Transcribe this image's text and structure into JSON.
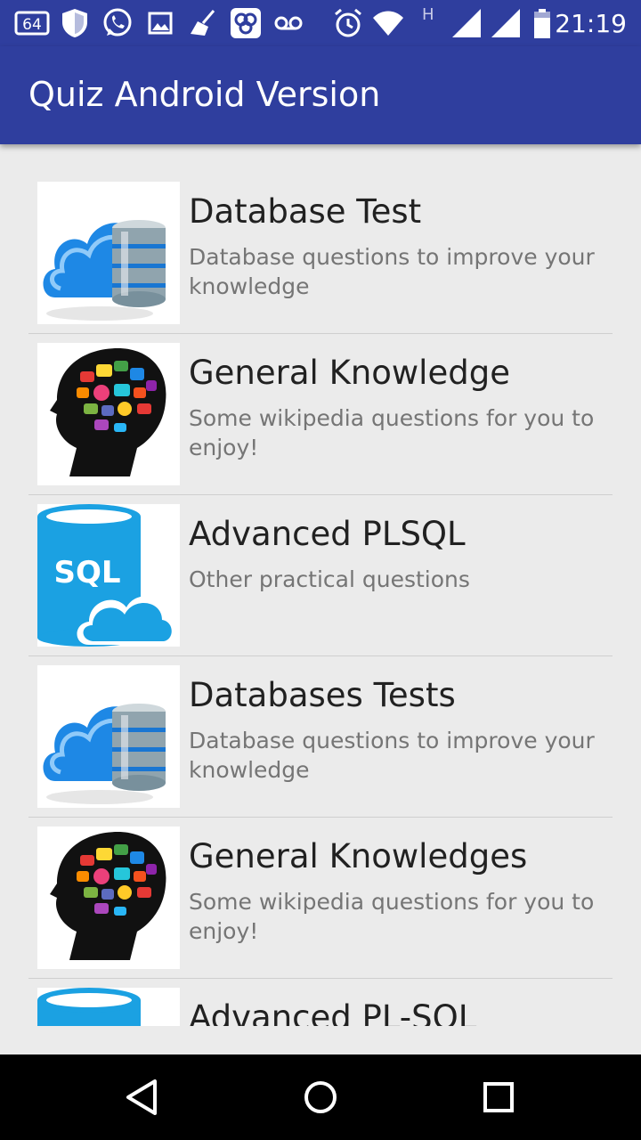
{
  "status_bar": {
    "notification_count": "64",
    "network_type": "H",
    "time": "21:19",
    "icons": [
      "notification-count-icon",
      "shield-icon",
      "whatsapp-icon",
      "image-icon",
      "cleaner-icon",
      "app-icon",
      "voicemail-icon",
      "alarm-icon",
      "wifi-icon",
      "network-h-icon",
      "signal-icon",
      "signal-icon",
      "battery-icon"
    ]
  },
  "app_bar": {
    "title": "Quiz Android Version",
    "color": "#2f3e9e"
  },
  "quizzes": [
    {
      "title": "Database Test",
      "description": "Database questions to improve your knowledge",
      "image": "database-cloud-image"
    },
    {
      "title": "General Knowledge",
      "description": "Some wikipedia questions for you to enjoy!",
      "image": "brain-head-image"
    },
    {
      "title": "Advanced PLSQL",
      "description": "Other practical questions",
      "image": "sql-cloud-image",
      "image_text": "SQL"
    },
    {
      "title": "Databases Tests",
      "description": "Database questions to improve your knowledge",
      "image": "database-cloud-image"
    },
    {
      "title": "General Knowledges",
      "description": "Some wikipedia questions for you to enjoy!",
      "image": "brain-head-image"
    },
    {
      "title": "Advanced PL-SQL",
      "description": "",
      "image": "sql-cloud-image"
    }
  ],
  "nav_bar": {
    "buttons": [
      "back-icon",
      "home-icon",
      "recents-icon"
    ]
  }
}
